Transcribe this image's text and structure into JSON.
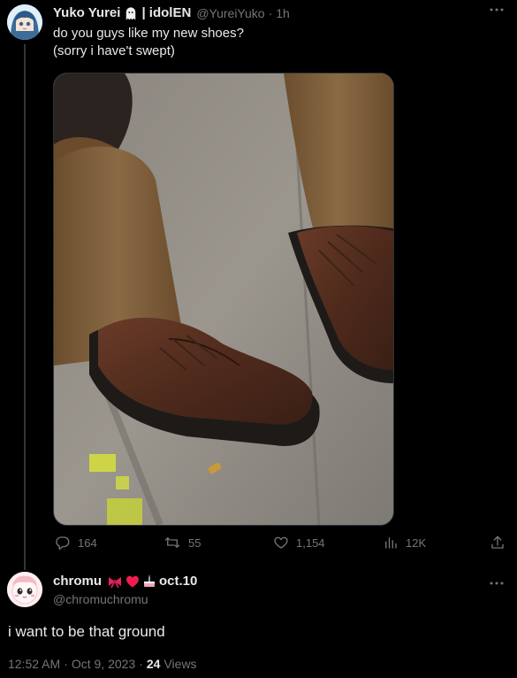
{
  "tweet": {
    "display_name": "Yuko Yurei",
    "name_suffix": "| idolEN",
    "handle": "@YureiYuko",
    "separator": "·",
    "time": "1h",
    "text_line1": "do you guys like my new shoes?",
    "text_line2": "(sorry i have't swept)",
    "actions": {
      "replies": "164",
      "retweets": "55",
      "likes": "1,154",
      "views": "12K"
    }
  },
  "reply": {
    "display_name": "chromu",
    "name_suffix": "oct.10",
    "handle": "@chromuchromu",
    "text": "i want to be that ground",
    "time": "12:52 AM",
    "separator": "·",
    "date": "Oct 9, 2023",
    "views_count": "24",
    "views_label": "Views"
  },
  "icons": {
    "more": "more-horizontal-icon",
    "reply": "reply-icon",
    "retweet": "retweet-icon",
    "like": "heart-icon",
    "views": "views-icon",
    "share": "share-icon"
  },
  "colors": {
    "background": "#000000",
    "text": "#e7e9ea",
    "muted": "#71767b",
    "divider": "#2f3336"
  }
}
